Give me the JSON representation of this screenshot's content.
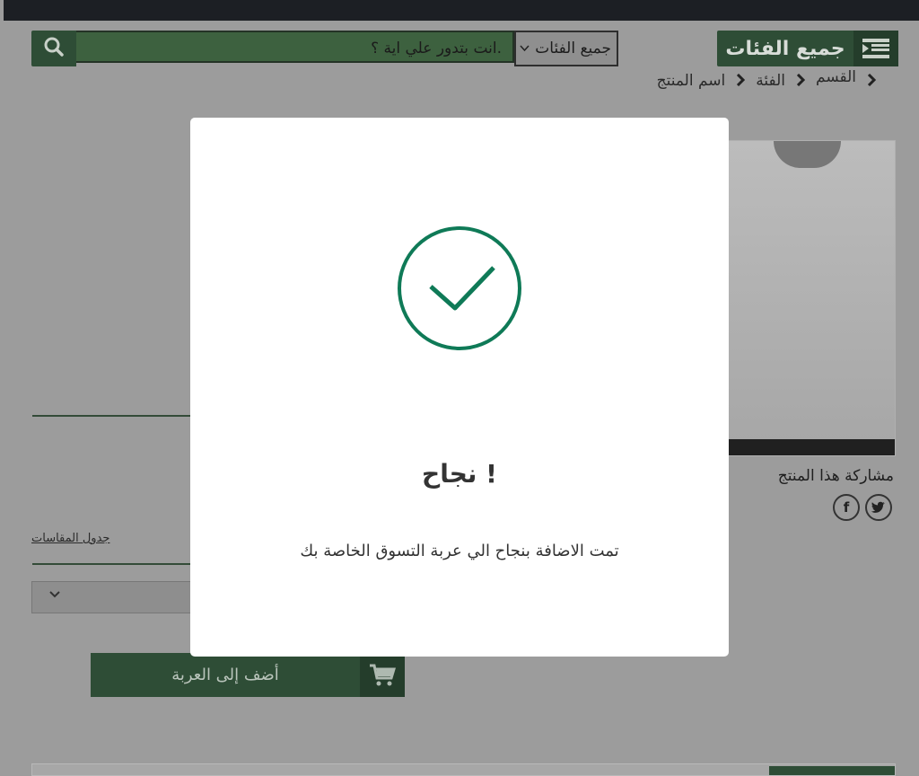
{
  "header": {
    "all_categories": "جميع الفئات",
    "search_placeholder": "انت بتدور علي اية ؟.",
    "category_select": "جميع الفئات"
  },
  "breadcrumb": {
    "items": [
      "القسم",
      "الفئة",
      "اسم المنتج"
    ]
  },
  "product": {
    "share_label": "مشاركة هذا المنتج",
    "size_chart_label": "جدول المقاسات",
    "add_to_cart": "أضف إلى العربة"
  },
  "modal": {
    "title": "نجاح !",
    "message": "تمت الاضافة بنجاح الي عربة التسوق الخاصة بك"
  },
  "icons": {
    "check": "checkmark-circle-icon",
    "search": "search-icon",
    "menu": "list-menu-icon",
    "cart": "cart-icon",
    "facebook": "facebook-icon",
    "twitter": "twitter-icon"
  },
  "colors": {
    "brand_green": "#1d7b55",
    "success_check": "#0f7a57",
    "overlay": "#9c9c9c"
  }
}
